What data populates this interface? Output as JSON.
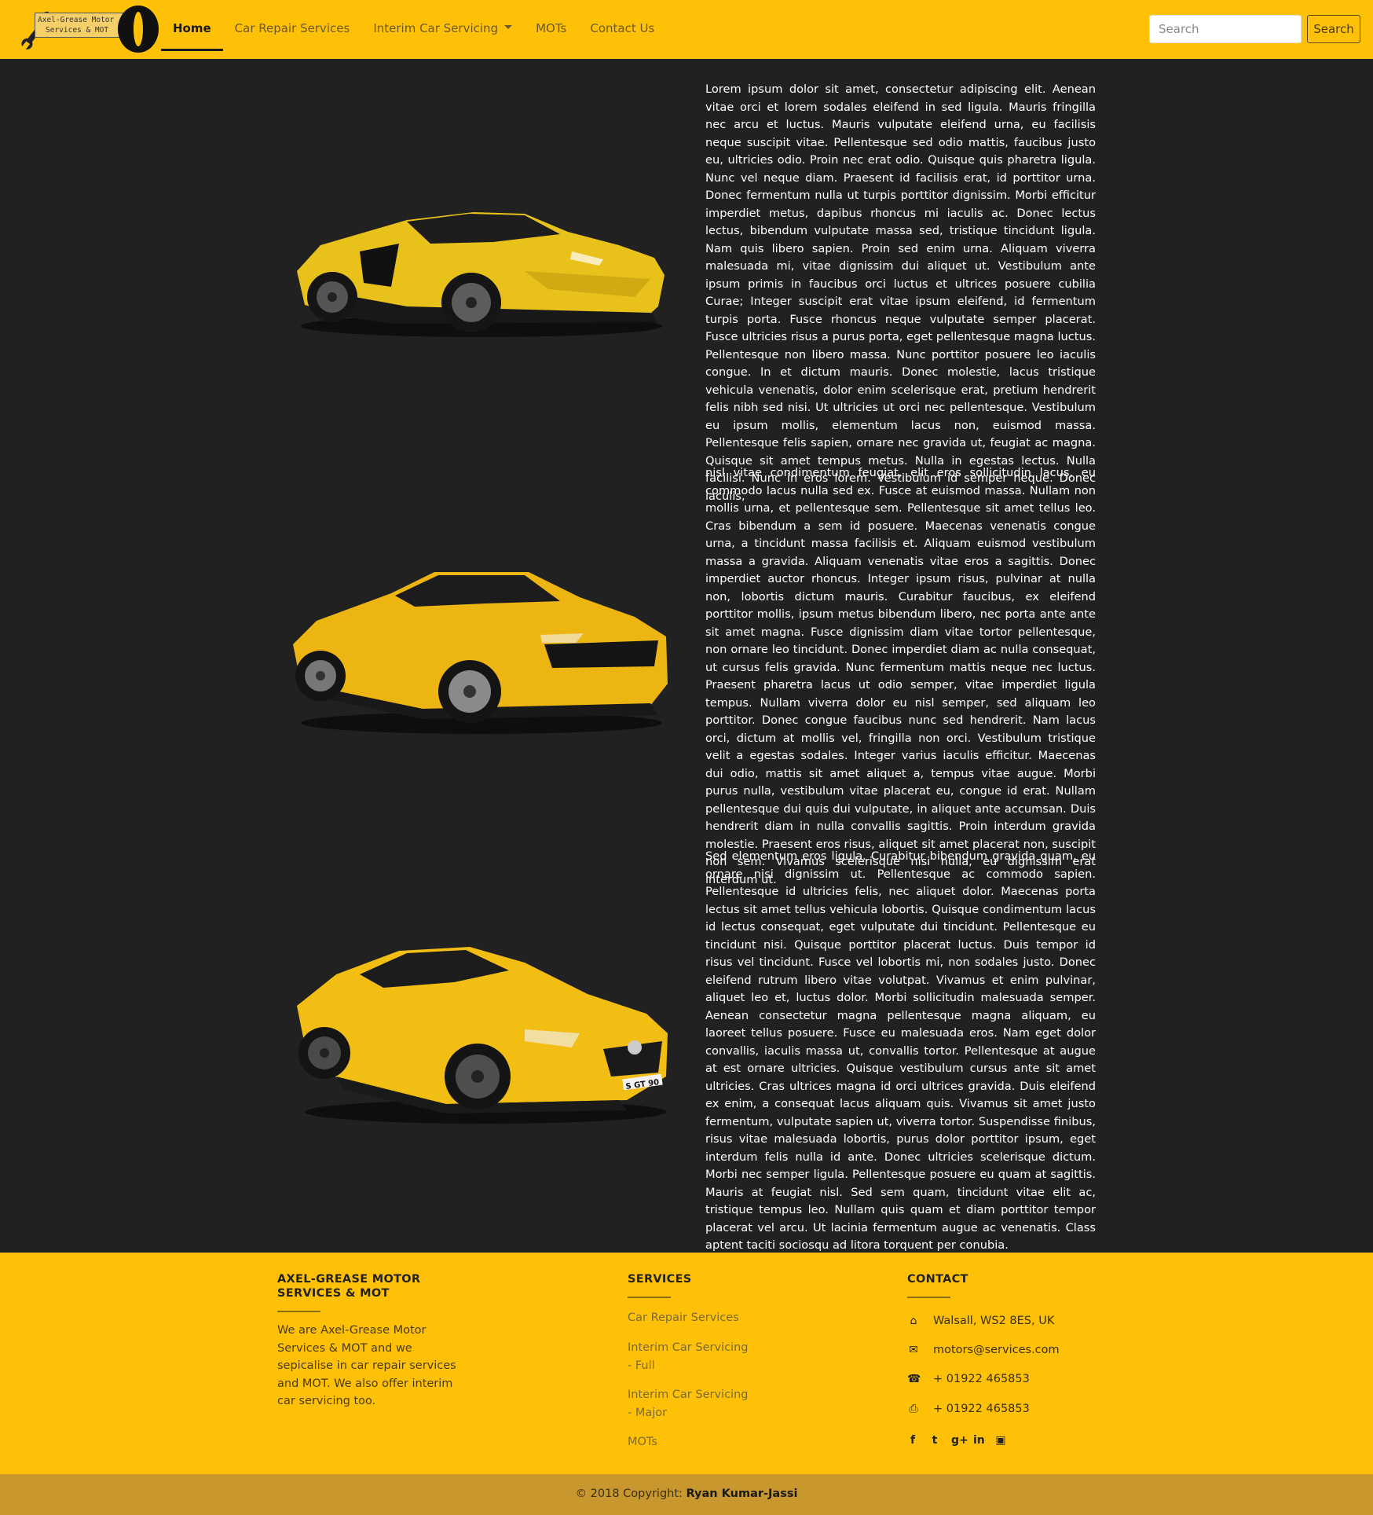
{
  "logo": {
    "line1": "Axel-Grease Motor",
    "line2": "Services & MOT"
  },
  "nav": {
    "items": [
      {
        "label": "Home",
        "active": true
      },
      {
        "label": "Car Repair Services"
      },
      {
        "label": "Interim Car Servicing",
        "dropdown": true
      },
      {
        "label": "MOTs"
      },
      {
        "label": "Contact Us"
      }
    ],
    "search_placeholder": "Search",
    "search_button": "Search"
  },
  "content": {
    "paragraphs": [
      "Lorem ipsum dolor sit amet, consectetur adipiscing elit. Aenean vitae orci et lorem sodales eleifend in sed ligula. Mauris fringilla nec arcu et luctus. Mauris vulputate eleifend urna, eu facilisis neque suscipit vitae. Pellentesque sed odio mattis, faucibus justo eu, ultricies odio. Proin nec erat odio. Quisque quis pharetra ligula. Nunc vel neque diam. Praesent id facilisis erat, id porttitor urna. Donec fermentum nulla ut turpis porttitor dignissim. Morbi efficitur imperdiet metus, dapibus rhoncus mi iaculis ac. Donec lectus lectus, bibendum vulputate massa sed, tristique tincidunt ligula. Nam quis libero sapien. Proin sed enim urna. Aliquam viverra malesuada mi, vitae dignissim dui aliquet ut. Vestibulum ante ipsum primis in faucibus orci luctus et ultrices posuere cubilia Curae; Integer suscipit erat vitae ipsum eleifend, id fermentum turpis porta. Fusce rhoncus neque vulputate semper placerat. Fusce ultricies risus a purus porta, eget pellentesque magna luctus. Pellentesque non libero massa. Nunc porttitor posuere leo iaculis congue. In et dictum mauris. Donec molestie, lacus tristique vehicula venenatis, dolor enim scelerisque erat, pretium hendrerit felis nibh sed nisi. Ut ultricies ut orci nec pellentesque. Vestibulum eu ipsum mollis, elementum lacus non, euismod massa. Pellentesque felis sapien, ornare nec gravida ut, feugiat ac magna. Quisque sit amet tempus metus. Nulla in egestas lectus. Nulla facilisi. Nunc in eros lorem. Vestibulum id semper neque. Donec iaculis,",
      "nisl vitae condimentum feugiat, elit eros sollicitudin lacus, eu commodo lacus nulla sed ex. Fusce at euismod massa. Nullam non mollis urna, et pellentesque sem. Pellentesque sit amet tellus leo. Cras bibendum a sem id posuere. Maecenas venenatis congue urna, a tincidunt massa facilisis et. Aliquam euismod vestibulum massa a gravida. Aliquam venenatis vitae eros a sagittis. Donec imperdiet auctor rhoncus. Integer ipsum risus, pulvinar at nulla non, lobortis dictum mauris. Curabitur faucibus, ex eleifend porttitor mollis, ipsum metus bibendum libero, nec porta ante ante sit amet magna. Fusce dignissim diam vitae tortor pellentesque, non ornare leo tincidunt. Donec imperdiet diam ac nulla consequat, ut cursus felis gravida. Nunc fermentum mattis neque nec luctus. Praesent pharetra lacus ut odio semper, vitae imperdiet ligula tempus. Nullam viverra dolor eu nisl semper, sed aliquam leo porttitor. Donec congue faucibus nunc sed hendrerit. Nam lacus orci, dictum at mollis vel, fringilla non orci. Vestibulum tristique velit a egestas sodales. Integer varius iaculis efficitur. Maecenas dui odio, mattis sit amet aliquet a, tempus vitae augue. Morbi purus nulla, vestibulum vitae placerat eu, congue id erat. Nullam pellentesque dui quis dui vulputate, in aliquet ante accumsan. Duis hendrerit diam in nulla convallis sagittis. Proin interdum gravida molestie. Praesent eros risus, aliquet sit amet placerat non, suscipit non sem. Vivamus scelerisque nisi nulla, eu dignissim erat interdum ut.",
      "Sed elementum eros ligula. Curabitur bibendum gravida quam, eu ornare nisi dignissim ut. Pellentesque ac commodo sapien. Pellentesque id ultricies felis, nec aliquet dolor. Maecenas porta lectus sit amet tellus vehicula lobortis. Quisque condimentum lacus id lectus consequat, eget vulputate dui tincidunt. Pellentesque eu tincidunt nisi. Quisque porttitor placerat luctus. Duis tempor id risus vel tincidunt. Fusce vel lobortis mi, non sodales justo. Donec eleifend rutrum libero vitae volutpat. Vivamus et enim pulvinar, aliquet leo et, luctus dolor. Morbi sollicitudin malesuada semper. Aenean consectetur magna pellentesque magna aliquam, eu laoreet tellus posuere. Fusce eu malesuada eros. Nam eget dolor convallis, iaculis massa ut, convallis tortor. Pellentesque at augue at est ornare ultricies. Quisque vestibulum cursus ante sit amet ultricies. Cras ultrices magna id orci ultrices gravida. Duis eleifend ex enim, a consequat lacus aliquam quis. Vivamus sit amet justo fermentum, vulputate sapien ut, viverra tortor. Suspendisse finibus, risus vitae malesuada lobortis, purus dolor porttitor ipsum, eget interdum felis nulla id ante. Donec ultricies scelerisque dictum. Morbi nec semper ligula. Pellentesque posuere eu quam at sagittis. Mauris at feugiat nisl. Sed sem quam, tincidunt vitae elit ac, tristique tempus leo. Nullam quis quam et diam porttitor tempor placerat vel arcu. Ut lacinia fermentum augue ac venenatis. Class aptent taciti sociosqu ad litora torquent per conubia."
    ],
    "car_plate": "S GT 90"
  },
  "footer": {
    "about_heading": "AXEL-GREASE MOTOR SERVICES & MOT",
    "about_text": "We are Axel-Grease Motor Services & MOT and we sepicalise in car repair services and MOT. We also offer interim car servicing too.",
    "services_heading": "SERVICES",
    "services": [
      "Car Repair Services",
      "Interim Car Servicing - Full",
      "Interim Car Servicing - Major",
      "MOTs"
    ],
    "contact_heading": "CONTACT",
    "contact": {
      "address": "Walsall, WS2 8ES, UK",
      "email": "motors@services.com",
      "phone": "+ 01922 465853",
      "fax": "+ 01922 465853"
    },
    "social_icons": [
      "facebook-icon",
      "twitter-icon",
      "google-plus-icon",
      "linkedin-icon",
      "instagram-icon"
    ],
    "copyright_prefix": "© 2018 Copyright:",
    "copyright_name": "Ryan Kumar-Jassi"
  },
  "colors": {
    "primary": "#FFC107",
    "background": "#212121",
    "copyright_bar": "#C8982E"
  }
}
